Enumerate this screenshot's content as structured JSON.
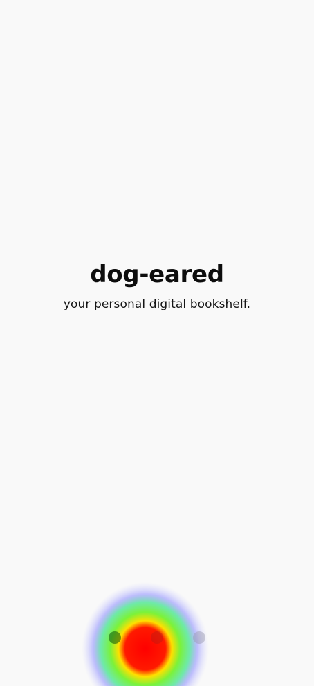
{
  "splash": {
    "title": "dog-eared",
    "subtitle": "your personal digital bookshelf."
  },
  "pager": {
    "page_count": 3,
    "active_index": 0
  },
  "colors": {
    "background": "#f9f9f9",
    "title": "#0d0d0d",
    "subtitle": "#151515"
  }
}
